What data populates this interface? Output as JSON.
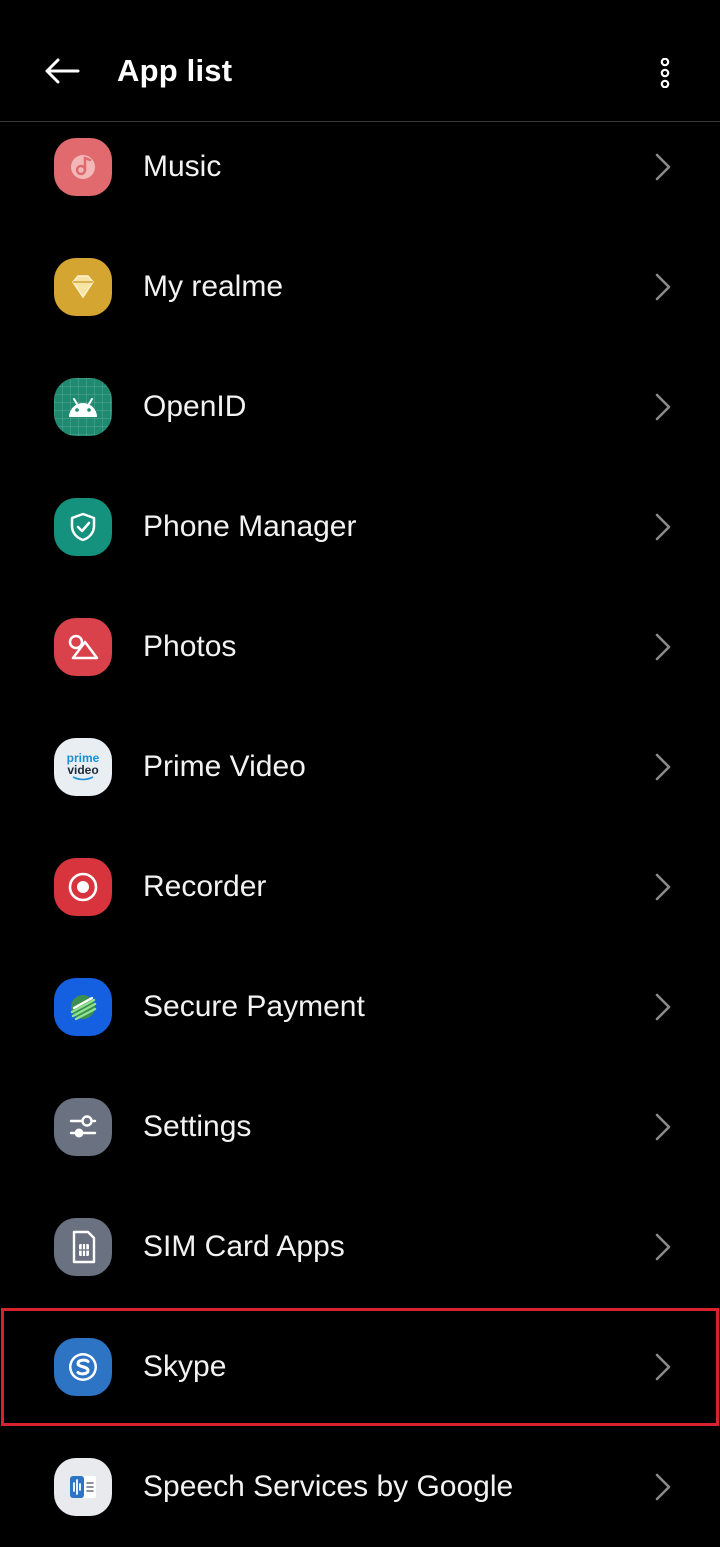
{
  "header": {
    "title": "App list",
    "back_icon": "arrow-left-icon",
    "menu_icon": "more-vertical-icon"
  },
  "apps": [
    {
      "label": "Music",
      "icon": "music-note-icon",
      "color": "#e06a6d"
    },
    {
      "label": "My realme",
      "icon": "diamond-icon",
      "color": "#d4a531"
    },
    {
      "label": "OpenID",
      "icon": "android-icon",
      "color": "#1f8a70"
    },
    {
      "label": "Phone Manager",
      "icon": "shield-check-icon",
      "color": "#14927e"
    },
    {
      "label": "Photos",
      "icon": "photos-icon",
      "color": "#d9424a"
    },
    {
      "label": "Prime Video",
      "icon": "prime-video-icon",
      "color": "#e9eef2",
      "icon_text_1": "prime",
      "icon_text_2": "video"
    },
    {
      "label": "Recorder",
      "icon": "record-icon",
      "color": "#d8343d"
    },
    {
      "label": "Secure Payment",
      "icon": "secure-payment-icon",
      "color": "#1560e0"
    },
    {
      "label": "Settings",
      "icon": "settings-sliders-icon",
      "color": "#6a7180"
    },
    {
      "label": "SIM Card Apps",
      "icon": "sim-card-icon",
      "color": "#6a7180"
    },
    {
      "label": "Skype",
      "icon": "skype-icon",
      "color": "#2d74c4",
      "highlighted": true
    },
    {
      "label": "Speech Services by Google",
      "icon": "speech-services-icon",
      "color": "#e8eaee"
    }
  ],
  "colors": {
    "background": "#000000",
    "text": "#f2f2f2",
    "divider": "#3a3a3a",
    "chevron": "#8a8a8a",
    "highlight": "#d6232f"
  }
}
